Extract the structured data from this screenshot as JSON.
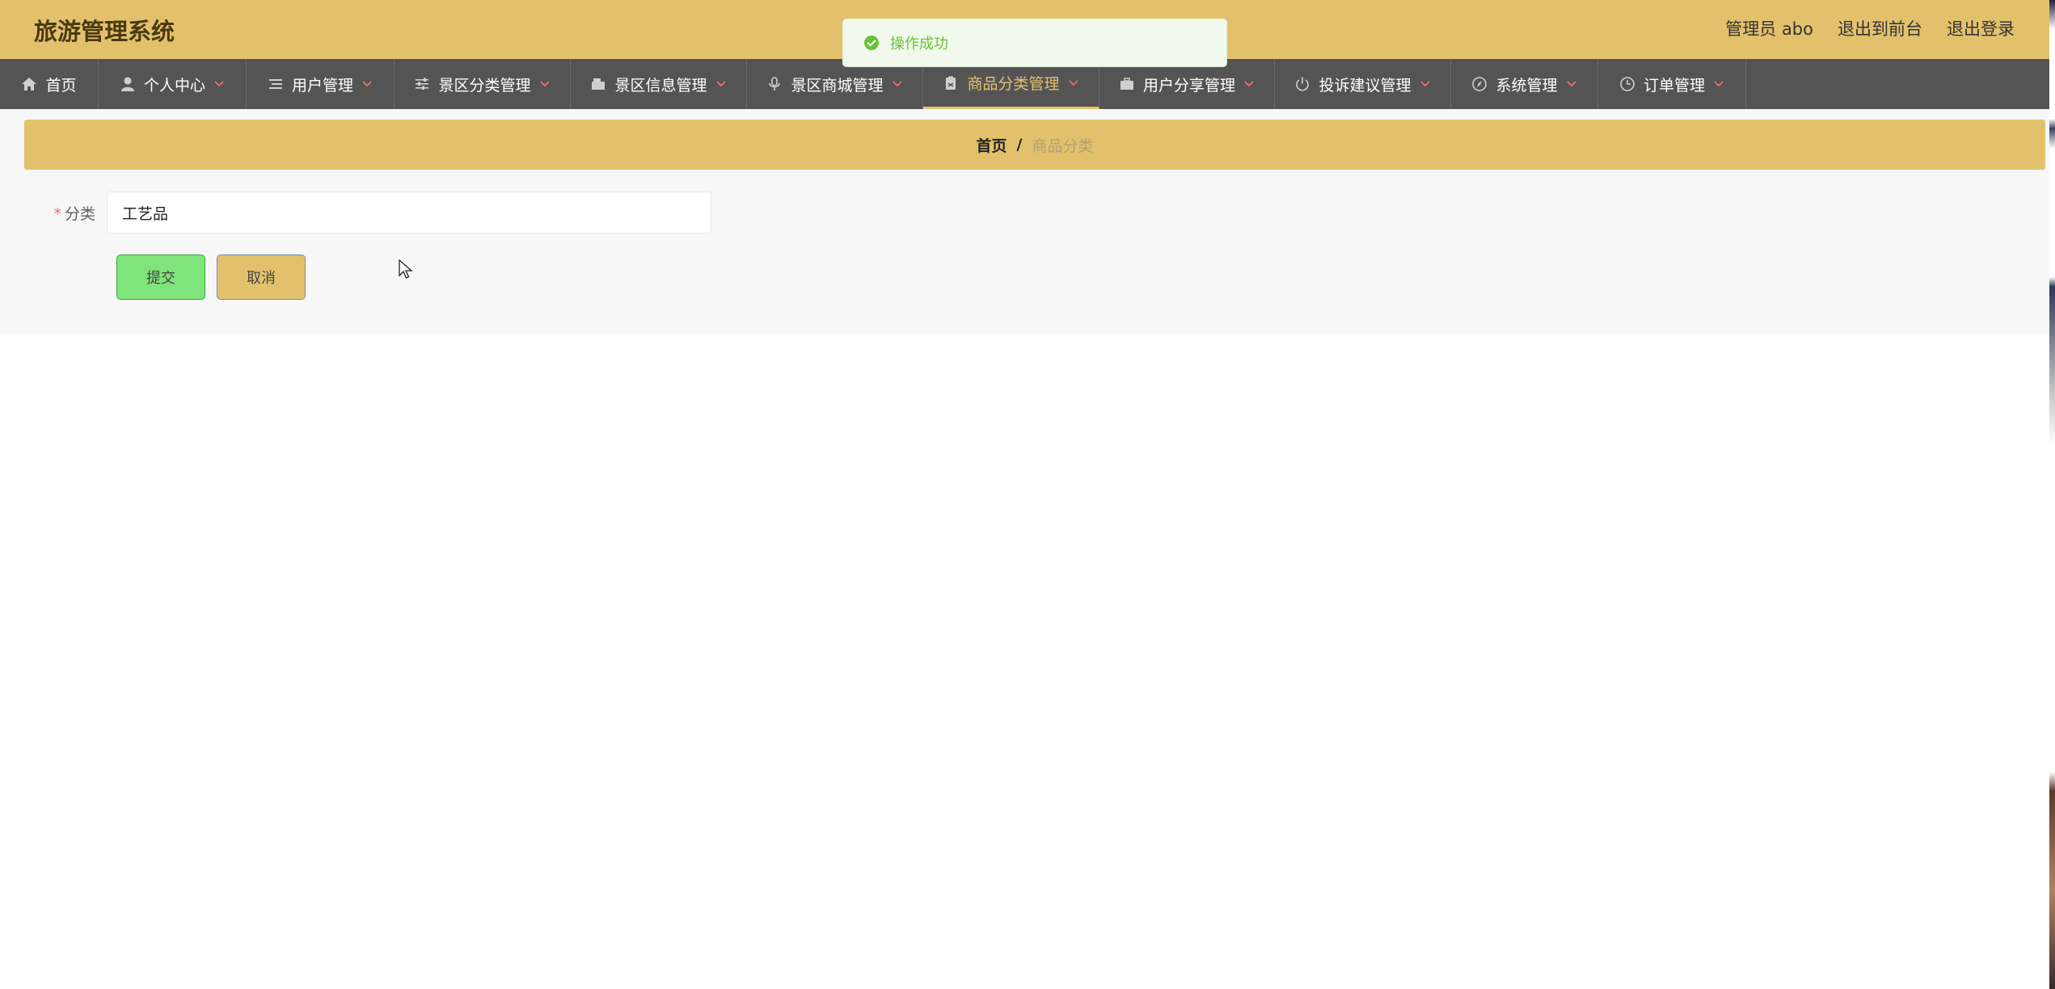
{
  "header": {
    "title": "旅游管理系统",
    "user_label": "管理员 abo",
    "to_front": "退出到前台",
    "logout": "退出登录"
  },
  "toast": {
    "message": "操作成功"
  },
  "nav": {
    "items": [
      {
        "label": "首页",
        "icon": "home-icon",
        "dropdown": false,
        "active": false
      },
      {
        "label": "个人中心",
        "icon": "user-icon",
        "dropdown": true,
        "active": false
      },
      {
        "label": "用户管理",
        "icon": "list-icon",
        "dropdown": true,
        "active": false
      },
      {
        "label": "景区分类管理",
        "icon": "sliders-icon",
        "dropdown": true,
        "active": false
      },
      {
        "label": "景区信息管理",
        "icon": "wallet-icon",
        "dropdown": true,
        "active": false
      },
      {
        "label": "景区商城管理",
        "icon": "microphone-icon",
        "dropdown": true,
        "active": false
      },
      {
        "label": "商品分类管理",
        "icon": "clipboard-icon",
        "dropdown": true,
        "active": true
      },
      {
        "label": "用户分享管理",
        "icon": "briefcase-icon",
        "dropdown": true,
        "active": false
      },
      {
        "label": "投诉建议管理",
        "icon": "power-icon",
        "dropdown": true,
        "active": false
      },
      {
        "label": "系统管理",
        "icon": "compass-icon",
        "dropdown": true,
        "active": false
      },
      {
        "label": "订单管理",
        "icon": "clock-icon",
        "dropdown": true,
        "active": false
      }
    ]
  },
  "breadcrumb": {
    "home": "首页",
    "separator": "/",
    "current": "商品分类"
  },
  "form": {
    "required_mark": "*",
    "category_label": "分类",
    "category_value": "工艺品"
  },
  "buttons": {
    "submit": "提交",
    "cancel": "取消"
  },
  "colors": {
    "accent": "#e3c16c",
    "nav_bg": "#545454",
    "success": "#67c23a",
    "submit_bg": "#7fe47b"
  }
}
